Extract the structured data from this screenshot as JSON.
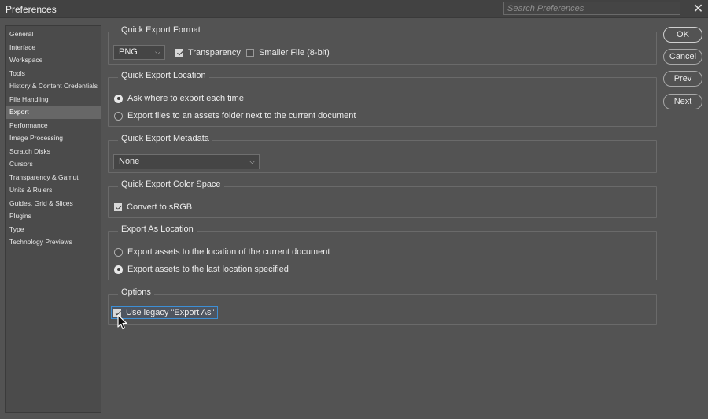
{
  "window": {
    "title": "Preferences",
    "search_placeholder": "Search Preferences"
  },
  "sidebar": {
    "items": [
      {
        "label": "General",
        "active": false
      },
      {
        "label": "Interface",
        "active": false
      },
      {
        "label": "Workspace",
        "active": false
      },
      {
        "label": "Tools",
        "active": false
      },
      {
        "label": "History & Content Credentials",
        "active": false
      },
      {
        "label": "File Handling",
        "active": false
      },
      {
        "label": "Export",
        "active": true
      },
      {
        "label": "Performance",
        "active": false
      },
      {
        "label": "Image Processing",
        "active": false
      },
      {
        "label": "Scratch Disks",
        "active": false
      },
      {
        "label": "Cursors",
        "active": false
      },
      {
        "label": "Transparency & Gamut",
        "active": false
      },
      {
        "label": "Units & Rulers",
        "active": false
      },
      {
        "label": "Guides, Grid & Slices",
        "active": false
      },
      {
        "label": "Plugins",
        "active": false
      },
      {
        "label": "Type",
        "active": false
      },
      {
        "label": "Technology Previews",
        "active": false
      }
    ]
  },
  "groups": {
    "format": {
      "title": "Quick Export Format",
      "format_value": "PNG",
      "transparency_label": "Transparency",
      "transparency_checked": true,
      "smaller_label": "Smaller File (8-bit)",
      "smaller_checked": false
    },
    "location": {
      "title": "Quick Export Location",
      "option1": "Ask where to export each time",
      "option2": "Export files to an assets folder next to the current document",
      "selected": 1
    },
    "metadata": {
      "title": "Quick Export Metadata",
      "value": "None"
    },
    "colorspace": {
      "title": "Quick Export Color Space",
      "convert_label": "Convert to sRGB",
      "convert_checked": true
    },
    "exportas": {
      "title": "Export As Location",
      "option1": "Export assets to the location of the current document",
      "option2": "Export assets to the last location specified",
      "selected": 2
    },
    "options": {
      "title": "Options",
      "legacy_label": "Use legacy \"Export As\"",
      "legacy_checked": true
    }
  },
  "buttons": {
    "ok": "OK",
    "cancel": "Cancel",
    "prev": "Prev",
    "next": "Next"
  },
  "icons": {
    "close": "close-icon",
    "chevron": "chevron-down-icon",
    "cursor": "mouse-pointer-icon"
  }
}
